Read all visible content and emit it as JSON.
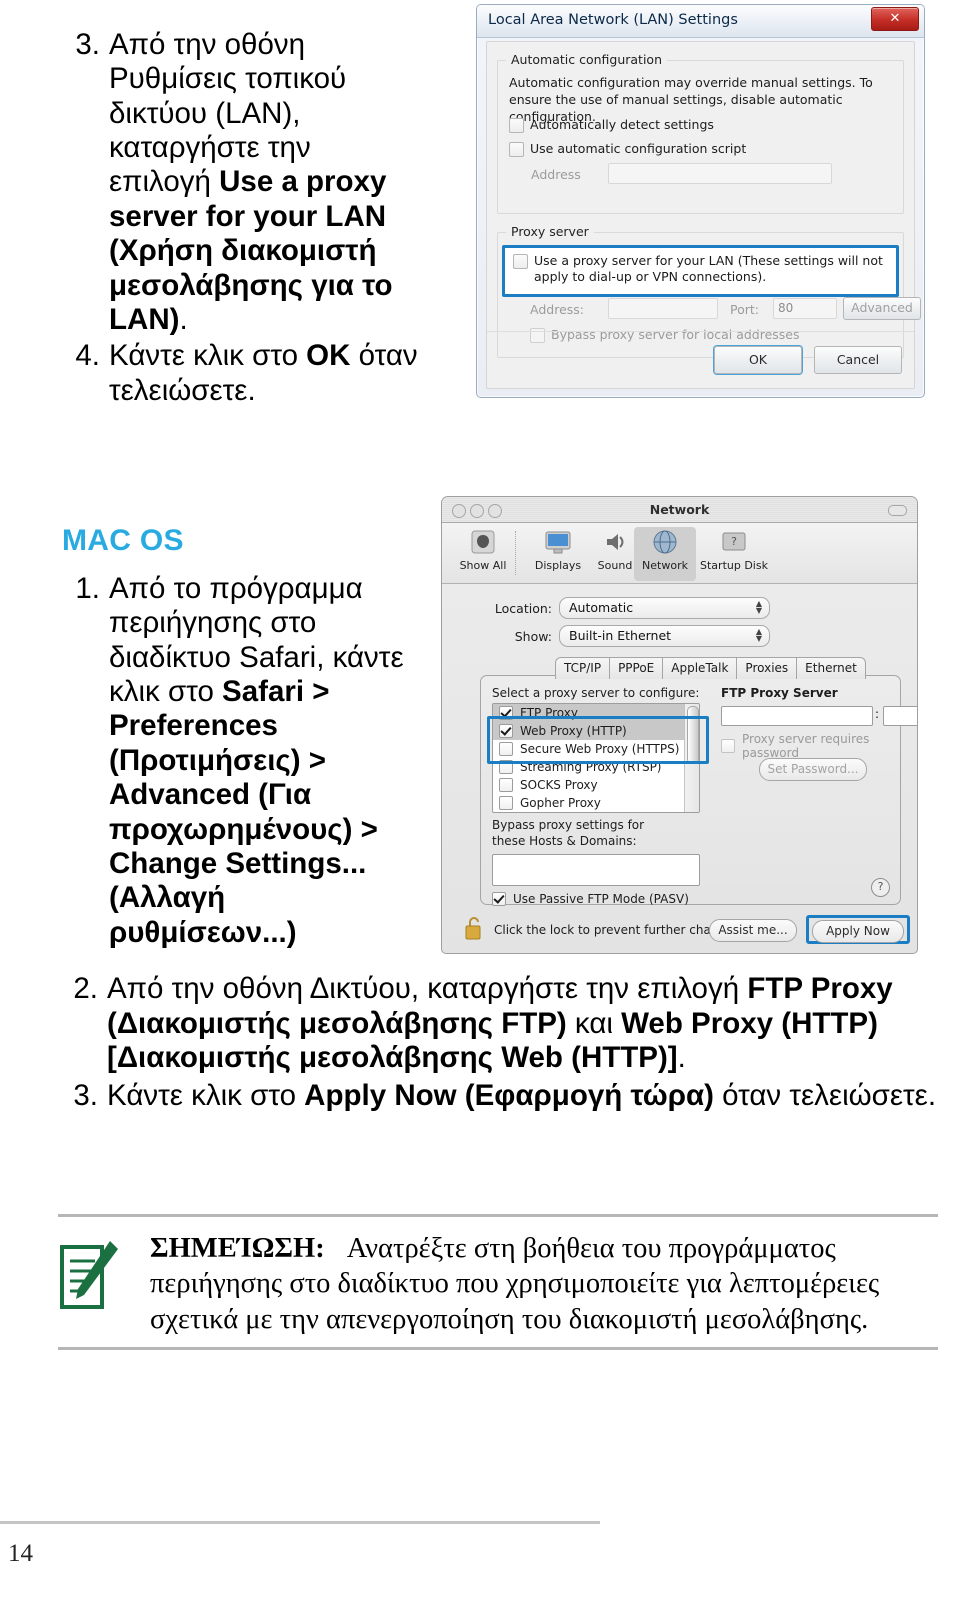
{
  "page": {
    "number": "14"
  },
  "windows_steps": [
    {
      "num": "3.",
      "parts": [
        {
          "t": "Από την οθόνη Ρυθμίσεις τοπικού δικτύου (LAN), καταργήστε την επιλογή ",
          "b": false
        },
        {
          "t": "Use a proxy server for your LAN (Χρήση διακομιστή μεσολάβησης για το LAN)",
          "b": true
        },
        {
          "t": ".",
          "b": false
        }
      ]
    },
    {
      "num": "4.",
      "parts": [
        {
          "t": "Κάντε κλικ στο ",
          "b": false
        },
        {
          "t": "OK",
          "b": true
        },
        {
          "t": " όταν τελειώσετε.",
          "b": false
        }
      ]
    }
  ],
  "mac_heading": "MAC OS",
  "mac_heading_color": "#29abe2",
  "mac_step1": {
    "num": "1.",
    "parts": [
      {
        "t": "Από το πρόγραμμα περιήγησης στο διαδίκτυο Safari, κάντε κλικ στο ",
        "b": false
      },
      {
        "t": "Safari > Preferences (Προτιμήσεις) > Advanced (Για προχωρημένους) > Change Settings... (Αλλαγή ρυθμίσεων...)",
        "b": true
      }
    ]
  },
  "mac_steps_rest": [
    {
      "num": "2.",
      "parts": [
        {
          "t": "Από την οθόνη Δικτύου, καταργήστε την επιλογή ",
          "b": false
        },
        {
          "t": "FTP Proxy (Διακομιστής μεσολάβησης FTP)",
          "b": true
        },
        {
          "t": " και ",
          "b": false
        },
        {
          "t": "Web Proxy (HTTP) [Διακομιστής μεσολάβησης Web (HTTP)]",
          "b": true
        },
        {
          "t": ".",
          "b": false
        }
      ]
    },
    {
      "num": "3.",
      "parts": [
        {
          "t": "Κάντε κλικ στο ",
          "b": false
        },
        {
          "t": "Apply Now (Εφαρμογή τώρα)",
          "b": true
        },
        {
          "t": " όταν τελειώσετε.",
          "b": false
        }
      ]
    }
  ],
  "note": {
    "label": "ΣΗΜΕΊΩΣΗ:",
    "text": "Ανατρέξτε στη βοήθεια του προγράμματος περιήγησης στο διαδίκτυο που χρησιμοποιείτε για λεπτομέρειες σχετικά με την απενεργοποίηση του διακομιστή μεσολάβησης.",
    "icon": "note-pencil-icon",
    "icon_color": "#1a7040"
  },
  "lan_dialog": {
    "title": "Local Area Network (LAN) Settings",
    "close_label": "✕",
    "auto_group": {
      "label": "Automatic configuration",
      "description": "Automatic configuration may override manual settings. To ensure the use of manual settings, disable automatic configuration.",
      "checkbox_detect": "Automatically detect settings",
      "checkbox_script": "Use automatic configuration script",
      "address_label": "Address",
      "address_value": ""
    },
    "proxy_group": {
      "label": "Proxy server",
      "use_proxy_checkbox": "Use a proxy server for your LAN (These settings will not apply to dial-up or VPN connections).",
      "address_label": "Address:",
      "address_value": "",
      "port_label": "Port:",
      "port_value": "80",
      "advanced_button": "Advanced",
      "bypass_checkbox": "Bypass proxy server for local addresses"
    },
    "ok_button": "OK",
    "cancel_button": "Cancel",
    "highlight_color": "#1b7dc4"
  },
  "mac_dialog": {
    "title": "Network",
    "toolbar": [
      {
        "label": "Show All",
        "icon": "show-all-icon",
        "selected": false
      },
      {
        "label": "Displays",
        "icon": "displays-icon",
        "selected": false
      },
      {
        "label": "Sound",
        "icon": "sound-icon",
        "selected": false
      },
      {
        "label": "Network",
        "icon": "network-globe-icon",
        "selected": true
      },
      {
        "label": "Startup Disk",
        "icon": "startup-disk-icon",
        "selected": false
      }
    ],
    "location_label": "Location:",
    "location_value": "Automatic",
    "show_label": "Show:",
    "show_value": "Built-in Ethernet",
    "tabs": [
      "TCP/IP",
      "PPPoE",
      "AppleTalk",
      "Proxies",
      "Ethernet"
    ],
    "select_proxy_label": "Select a proxy server to configure:",
    "proxy_list": [
      {
        "label": "FTP Proxy",
        "checked": true,
        "selected": true
      },
      {
        "label": "Web Proxy (HTTP)",
        "checked": true,
        "selected": true
      },
      {
        "label": "Secure Web Proxy (HTTPS)",
        "checked": false,
        "selected": false
      },
      {
        "label": "Streaming Proxy (RTSP)",
        "checked": false,
        "selected": false
      },
      {
        "label": "SOCKS Proxy",
        "checked": false,
        "selected": false
      },
      {
        "label": "Gopher Proxy",
        "checked": false,
        "selected": false
      }
    ],
    "ftp_proxy_server_label": "FTP Proxy Server",
    "ftp_server_value": "",
    "ftp_port_value": "",
    "requires_password_label": "Proxy server requires password",
    "set_password_button": "Set Password...",
    "bypass_label_line1": "Bypass proxy settings for",
    "bypass_label_line2": "these Hosts & Domains:",
    "bypass_value": "",
    "pasv_label": "Use Passive FTP Mode (PASV)",
    "help_label": "?",
    "lock_text": "Click the lock to prevent further changes.",
    "assist_button": "Assist me...",
    "apply_button": "Apply Now",
    "highlight_color": "#1b7dc4"
  }
}
